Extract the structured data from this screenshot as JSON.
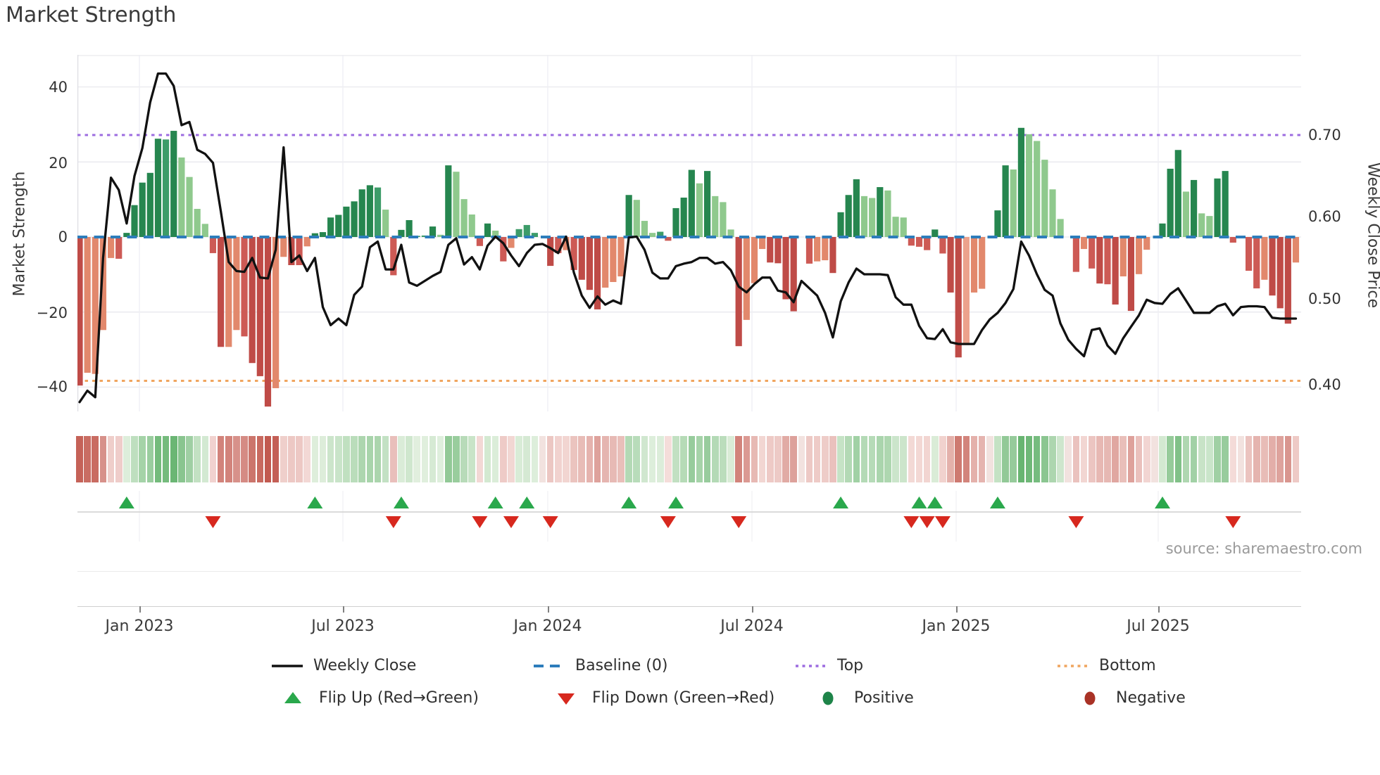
{
  "title": "Market Strength",
  "source": "source: sharemaestro.com",
  "axes": {
    "left_label": "Market Strength",
    "right_label": "Weekly Close Price",
    "left_ticks": [
      "40",
      "20",
      "0",
      "−20",
      "−40"
    ],
    "right_ticks": [
      "0.70",
      "0.60",
      "0.50",
      "0.40"
    ],
    "x_ticks": [
      "Jan 2023",
      "Jul 2023",
      "Jan 2024",
      "Jul 2024",
      "Jan 2025",
      "Jul 2025"
    ]
  },
  "legend": {
    "weekly_close": "Weekly Close",
    "baseline": "Baseline (0)",
    "top": "Top",
    "bottom": "Bottom",
    "flip_up": "Flip Up (Red→Green)",
    "flip_down": "Flip Down (Green→Red)",
    "positive": "Positive",
    "negative": "Negative"
  },
  "colors": {
    "line": "#111111",
    "baseline": "#2d7dbb",
    "top_line": "#9d6ce0",
    "bottom_line": "#f0a55f",
    "flip_up": "#2aa84c",
    "flip_down": "#d7281e",
    "positive_dot": "#1e8449",
    "negative_dot": "#a93226",
    "grid": "#e9e9ee",
    "bar_palette": {
      "dr": "#bf4b47",
      "r": "#cd5a55",
      "s": "#e2886c",
      "ls": "#eca28c",
      "dg": "#26864f",
      "g": "#3d9c69",
      "lg": "#8fc98d",
      "none": "#ffffff"
    }
  },
  "chart_data": {
    "type": "bar+line",
    "title": "Market Strength",
    "x_start_date": "2022-11-07",
    "x_interval": "weekly",
    "n_weeks": 156,
    "left_axis": {
      "label": "Market Strength",
      "lim": [
        -46.5,
        48.6
      ],
      "gridlines": [
        40,
        20,
        0,
        -20,
        -40
      ]
    },
    "right_axis": {
      "label": "Weekly Close Price",
      "lim": [
        0.363,
        0.798
      ],
      "ticks": [
        0.7,
        0.6,
        0.5,
        0.4
      ]
    },
    "baseline_value": 0,
    "top_level": {
      "price": 0.7,
      "strength_equiv": 27.3
    },
    "bottom_level": {
      "price": 0.4,
      "strength_equiv": -38.4
    },
    "bar_values": [
      -39.6,
      -36.2,
      -36.5,
      -24.8,
      -5.6,
      -5.8,
      1.1,
      8.5,
      14.5,
      17.1,
      26.2,
      26.0,
      28.3,
      21.2,
      16.0,
      7.5,
      3.5,
      -4.3,
      -29.3,
      -29.3,
      -24.8,
      -26.5,
      -33.6,
      -37.1,
      -45.2,
      -40.3,
      -5.3,
      -7.5,
      -7.5,
      -2.5,
      1.0,
      1.3,
      5.2,
      5.9,
      8.1,
      9.5,
      12.7,
      13.8,
      13.2,
      7.3,
      -10.2,
      1.9,
      4.5,
      0.3,
      0.4,
      2.8,
      0.6,
      19.1,
      17.4,
      10.1,
      6.0,
      -2.4,
      3.6,
      1.7,
      -6.5,
      -2.9,
      2.1,
      3.2,
      1.1,
      0,
      -7.7,
      -4.3,
      -3.5,
      -8.8,
      -11.4,
      -14.1,
      -19.3,
      -13.5,
      -12.0,
      -10.5,
      11.2,
      9.9,
      4.3,
      1.1,
      1.4,
      -1.0,
      7.7,
      10.5,
      17.9,
      14.3,
      17.6,
      10.9,
      9.3,
      2.0,
      -29.1,
      -22.1,
      -12.3,
      -3.2,
      -6.8,
      -7.0,
      -16.6,
      -19.8,
      0,
      -7.1,
      -6.5,
      -6.2,
      -9.6,
      6.6,
      11.2,
      15.4,
      10.9,
      10.4,
      13.3,
      12.4,
      5.4,
      5.2,
      -2.3,
      -2.6,
      -3.5,
      2.0,
      -4.4,
      -14.8,
      -32.1,
      -28.8,
      -14.8,
      -13.8,
      0,
      7.1,
      19.1,
      18.0,
      29.1,
      27.4,
      25.6,
      20.6,
      12.7,
      4.8,
      0,
      -9.3,
      -3.2,
      -8.4,
      -12.4,
      -12.6,
      -18.0,
      -10.5,
      -19.7,
      -9.9,
      -3.4,
      0,
      3.6,
      18.2,
      23.2,
      12.1,
      15.2,
      6.3,
      5.6,
      15.6,
      17.6,
      -1.5,
      0,
      -9.0,
      -13.7,
      -11.4,
      -15.6,
      -19.0,
      -23.1,
      -6.8
    ],
    "bar_colors": [
      "dr",
      "s",
      "s",
      "s",
      "s",
      "r",
      "dg",
      "dg",
      "dg",
      "dg",
      "dg",
      "g",
      "dg",
      "lg",
      "lg",
      "lg",
      "lg",
      "r",
      "dr",
      "s",
      "s",
      "r",
      "dr",
      "dr",
      "dr",
      "s",
      "s",
      "dr",
      "r",
      "s",
      "dg",
      "dg",
      "dg",
      "dg",
      "dg",
      "dg",
      "dg",
      "dg",
      "g",
      "lg",
      "r",
      "dg",
      "dg",
      "g",
      "g",
      "dg",
      "lg",
      "dg",
      "lg",
      "lg",
      "lg",
      "r",
      "dg",
      "lg",
      "r",
      "s",
      "g",
      "g",
      "g",
      "none",
      "dr",
      "r",
      "s",
      "r",
      "dr",
      "dr",
      "dr",
      "s",
      "s",
      "s",
      "dg",
      "lg",
      "lg",
      "lg",
      "g",
      "r",
      "dg",
      "dg",
      "dg",
      "lg",
      "dg",
      "lg",
      "lg",
      "lg",
      "dr",
      "s",
      "s",
      "s",
      "dr",
      "dr",
      "dr",
      "dr",
      "none",
      "r",
      "s",
      "s",
      "dr",
      "dg",
      "dg",
      "dg",
      "lg",
      "lg",
      "dg",
      "lg",
      "lg",
      "lg",
      "r",
      "r",
      "r",
      "dg",
      "r",
      "dr",
      "dr",
      "ls",
      "s",
      "s",
      "none",
      "dg",
      "dg",
      "lg",
      "dg",
      "lg",
      "lg",
      "lg",
      "lg",
      "lg",
      "none",
      "r",
      "s",
      "r",
      "dr",
      "r",
      "dr",
      "s",
      "dr",
      "s",
      "s",
      "none",
      "dg",
      "dg",
      "dg",
      "lg",
      "dg",
      "lg",
      "lg",
      "dg",
      "dg",
      "r",
      "none",
      "r",
      "r",
      "s",
      "dr",
      "dr",
      "dr",
      "s"
    ],
    "line_prices": [
      0.374,
      0.388,
      0.38,
      0.55,
      0.648,
      0.633,
      0.592,
      0.65,
      0.684,
      0.74,
      0.775,
      0.775,
      0.76,
      0.712,
      0.716,
      0.682,
      0.677,
      0.666,
      0.607,
      0.545,
      0.534,
      0.533,
      0.55,
      0.526,
      0.525,
      0.56,
      0.685,
      0.545,
      0.553,
      0.534,
      0.55,
      0.49,
      0.468,
      0.476,
      0.468,
      0.505,
      0.515,
      0.563,
      0.57,
      0.536,
      0.536,
      0.566,
      0.52,
      0.516,
      0.522,
      0.528,
      0.533,
      0.566,
      0.574,
      0.542,
      0.551,
      0.536,
      0.565,
      0.576,
      0.568,
      0.553,
      0.54,
      0.556,
      0.566,
      0.567,
      0.562,
      0.556,
      0.576,
      0.532,
      0.504,
      0.489,
      0.503,
      0.493,
      0.498,
      0.494,
      0.575,
      0.576,
      0.56,
      0.532,
      0.525,
      0.525,
      0.54,
      0.543,
      0.545,
      0.55,
      0.55,
      0.543,
      0.545,
      0.535,
      0.515,
      0.508,
      0.518,
      0.526,
      0.526,
      0.51,
      0.508,
      0.496,
      0.522,
      0.513,
      0.504,
      0.483,
      0.453,
      0.497,
      0.52,
      0.537,
      0.53,
      0.53,
      0.53,
      0.529,
      0.502,
      0.493,
      0.493,
      0.467,
      0.452,
      0.451,
      0.463,
      0.447,
      0.445,
      0.445,
      0.445,
      0.462,
      0.475,
      0.483,
      0.495,
      0.512,
      0.57,
      0.553,
      0.53,
      0.511,
      0.504,
      0.47,
      0.45,
      0.439,
      0.43,
      0.462,
      0.464,
      0.443,
      0.433,
      0.452,
      0.466,
      0.48,
      0.499,
      0.495,
      0.494,
      0.506,
      0.513,
      0.498,
      0.483,
      0.483,
      0.483,
      0.491,
      0.494,
      0.48,
      0.49,
      0.491,
      0.491,
      0.49,
      0.477,
      0.476,
      0.476,
      0.476
    ],
    "flip_up_weeks": [
      7,
      31,
      42,
      54,
      58,
      71,
      77,
      98,
      108,
      110,
      118,
      139
    ],
    "flip_down_weeks": [
      18,
      41,
      52,
      56,
      61,
      76,
      85,
      107,
      109,
      111,
      128,
      148
    ],
    "legend_entries": [
      "Weekly Close",
      "Baseline (0)",
      "Top",
      "Bottom",
      "Flip Up (Red→Green)",
      "Flip Down (Green→Red)",
      "Positive",
      "Negative"
    ]
  }
}
